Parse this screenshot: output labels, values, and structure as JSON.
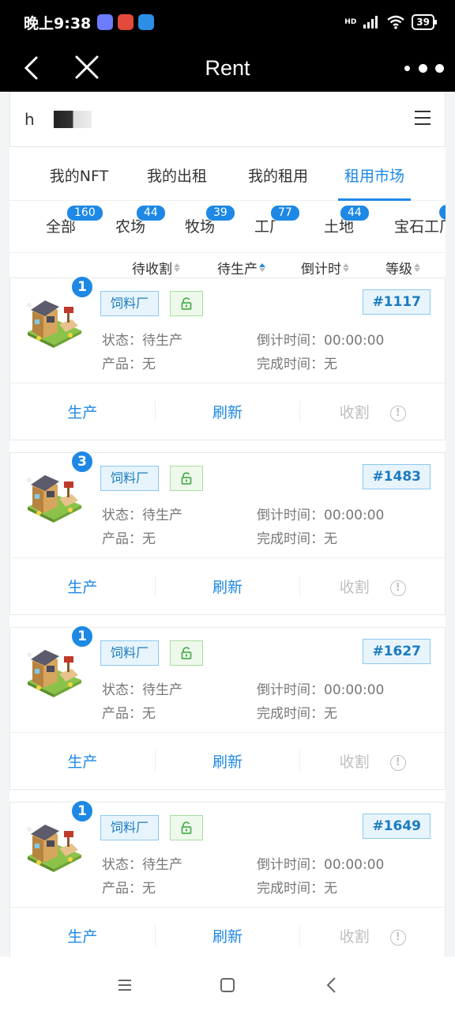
{
  "status_bar": {
    "time": "晚上9:38",
    "signal": "HD",
    "battery": "39"
  },
  "title_bar": {
    "title": "Rent"
  },
  "address": {
    "text": "h"
  },
  "tabs": [
    {
      "label": "我的NFT",
      "active": false
    },
    {
      "label": "我的出租",
      "active": false
    },
    {
      "label": "我的租用",
      "active": false
    },
    {
      "label": "租用市场",
      "active": true
    }
  ],
  "categories": [
    {
      "label": "全部",
      "count": "160"
    },
    {
      "label": "农场",
      "count": "44"
    },
    {
      "label": "牧场",
      "count": "39"
    },
    {
      "label": "工厂",
      "count": "77"
    },
    {
      "label": "土地",
      "count": "44"
    },
    {
      "label": "宝石工厂",
      "count": ""
    }
  ],
  "sorts": [
    {
      "label": "待收割",
      "active": false
    },
    {
      "label": "待生产",
      "active": true
    },
    {
      "label": "倒计时",
      "active": false
    },
    {
      "label": "等级",
      "active": false
    }
  ],
  "cards": [
    {
      "badge": "1",
      "type": "饲料厂",
      "id": "#1117",
      "status_label": "状态：",
      "status": "待生产",
      "product_label": "产品：",
      "product": "无",
      "countdown_label": "倒计时间：",
      "countdown": "00:00:00",
      "finish_label": "完成时间：",
      "finish": "无"
    },
    {
      "badge": "3",
      "type": "饲料厂",
      "id": "#1483",
      "status_label": "状态：",
      "status": "待生产",
      "product_label": "产品：",
      "product": "无",
      "countdown_label": "倒计时间：",
      "countdown": "00:00:00",
      "finish_label": "完成时间：",
      "finish": "无"
    },
    {
      "badge": "1",
      "type": "饲料厂",
      "id": "#1627",
      "status_label": "状态：",
      "status": "待生产",
      "product_label": "产品：",
      "product": "无",
      "countdown_label": "倒计时间：",
      "countdown": "00:00:00",
      "finish_label": "完成时间：",
      "finish": "无"
    },
    {
      "badge": "1",
      "type": "饲料厂",
      "id": "#1649",
      "status_label": "状态：",
      "status": "待生产",
      "product_label": "产品：",
      "product": "无",
      "countdown_label": "倒计时间：",
      "countdown": "00:00:00",
      "finish_label": "完成时间：",
      "finish": "无"
    }
  ],
  "card_actions": {
    "produce": "生产",
    "refresh": "刷新",
    "harvest": "收割"
  },
  "colors": {
    "accent": "#1e88e5",
    "tag_blue_bg": "#e8f4fc",
    "tag_green_bg": "#eef9ec",
    "disabled": "#c0c0c0"
  },
  "icons": {
    "back": "back-arrow-icon",
    "close": "close-icon",
    "more": "more-dots-icon",
    "menu": "menu-icon",
    "lock": "unlock-icon",
    "info": "info-icon"
  }
}
